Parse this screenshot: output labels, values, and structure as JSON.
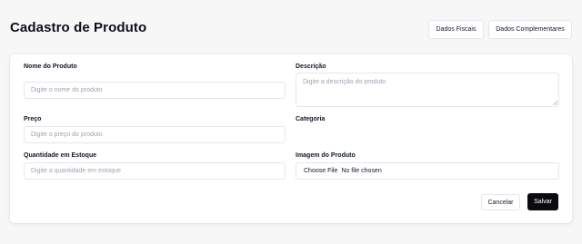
{
  "header": {
    "title": "Cadastro de Produto",
    "btn_fiscais": "Dados Fiscais",
    "btn_complementares": "Dados Complementares"
  },
  "form": {
    "nome": {
      "label": "Nome do Produto",
      "placeholder": "Digite o nome do produto"
    },
    "descricao": {
      "label": "Descrição",
      "placeholder": "Digite a descrição do produto"
    },
    "preco": {
      "label": "Preço",
      "placeholder": "Digite o preço do produto"
    },
    "categoria": {
      "label": "Categoria"
    },
    "quantidade": {
      "label": "Quantidade em Estoque",
      "placeholder": "Digite a quantidade em estoque"
    },
    "imagem": {
      "label": "Imagem do Produto",
      "choose": "Choose File",
      "status": "No file chosen"
    }
  },
  "actions": {
    "cancel": "Cancelar",
    "save": "Salvar"
  }
}
